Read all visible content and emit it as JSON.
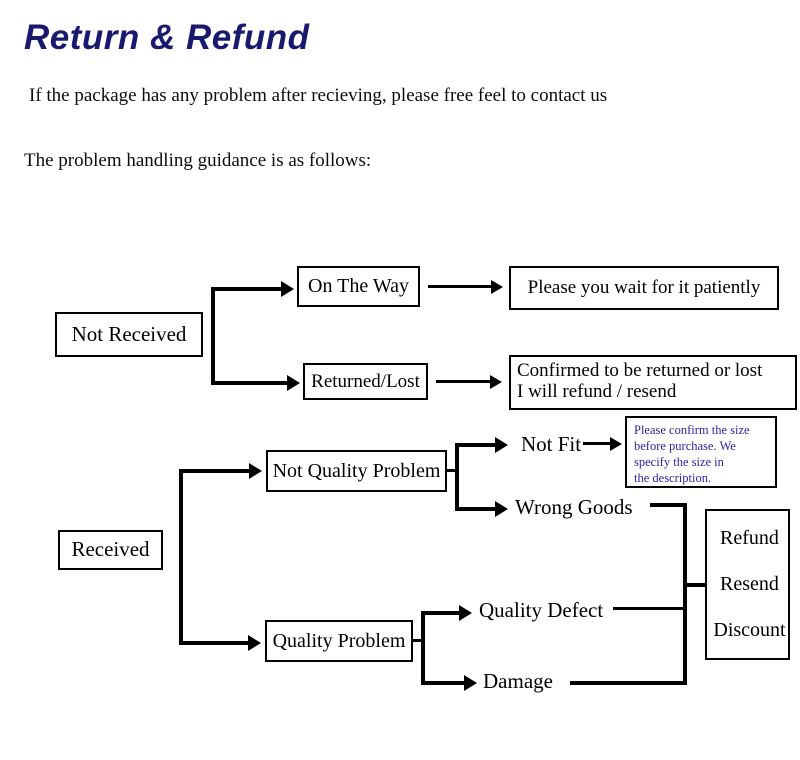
{
  "header": {
    "title": "Return & Refund",
    "title_color": "#191970",
    "intro_line_1": "If  the package has any problem after recieving, please  free feel to contact us",
    "intro_line_2": "The problem handling guidance is as follows:"
  },
  "flowchart": {
    "root_not_received": "Not Received",
    "root_received": "Received",
    "not_received_branches": {
      "on_the_way": "On The Way",
      "returned_lost": "Returned/Lost"
    },
    "outcomes": {
      "wait_patiently": "Please you wait for it patiently",
      "confirmed_line_1": "Confirmed to be returned or lost",
      "confirmed_line_2": "I will refund / resend"
    },
    "received_branches": {
      "not_quality_problem": "Not Quality Problem",
      "quality_problem": "Quality Problem"
    },
    "not_quality_leaves": {
      "not_fit": "Not Fit",
      "wrong_goods": "Wrong Goods"
    },
    "quality_leaves": {
      "quality_defect": "Quality Defect",
      "damage": "Damage"
    },
    "size_note": {
      "line_1": "Please confirm the size",
      "line_2": "before purchase.  We",
      "line_3": "specify the size in",
      "line_4": " the description.",
      "text_color": "#2e1ea8"
    },
    "resolution_box": {
      "option_1": "Refund",
      "option_2": "Resend",
      "option_3": "Discount"
    }
  }
}
